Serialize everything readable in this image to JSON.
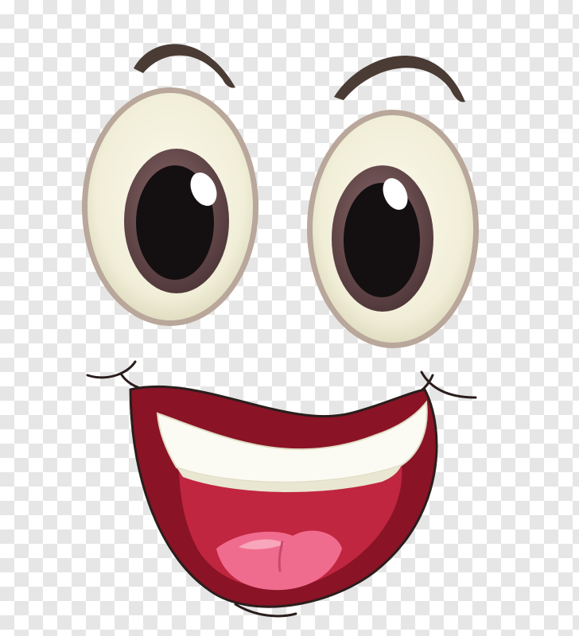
{
  "image": {
    "subject": "cartoon-happy-face",
    "background": "transparency-checkerboard"
  },
  "colors": {
    "checker_light": "#ffffff",
    "checker_dark": "#e6e6e6",
    "eyebrow": "#4a3b35",
    "sclera": "#f3f0de",
    "sclera_shade": "#d9d5b8",
    "eye_outline": "#b8a79a",
    "iris": "#6e5052",
    "pupil": "#140f10",
    "highlight": "#ffffff",
    "outline": "#2a1e1c",
    "mouth": "#8a1326",
    "mouth_inner": "#c0263f",
    "teeth": "#fbfbf4",
    "teeth_shade": "#e9e6d2",
    "tongue": "#f06c8e",
    "tongue_light": "#f8a6bb"
  },
  "parts": [
    "left-eyebrow",
    "right-eyebrow",
    "left-eye",
    "right-eye",
    "mouth",
    "teeth",
    "tongue",
    "left-cheek-dimple",
    "right-cheek-dimple"
  ]
}
